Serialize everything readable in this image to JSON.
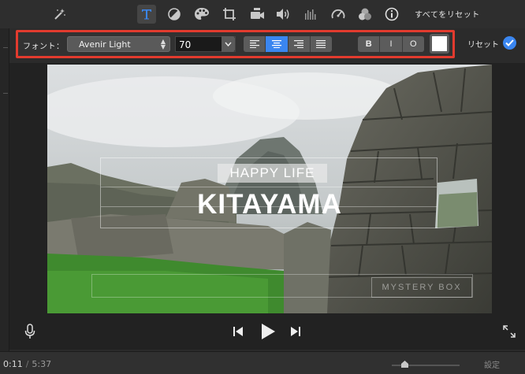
{
  "toolbar": {
    "icons": [
      "magic-wand-icon",
      "title-text-icon",
      "color-balance-icon",
      "color-palette-icon",
      "crop-icon",
      "camera-stabilization-icon",
      "volume-icon",
      "equalizer-icon",
      "speed-icon",
      "filter-icon",
      "info-icon"
    ],
    "active_icon": "title-text-icon",
    "reset_all_label": "すべてをリセット"
  },
  "font_bar": {
    "label": "フォント：",
    "font_name": "Avenir Light",
    "font_size": "70",
    "alignment_options": [
      "left",
      "center",
      "right",
      "justify"
    ],
    "selected_alignment": "center",
    "style_buttons": [
      "B",
      "I",
      "O"
    ],
    "text_color": "#ffffff",
    "reset_label": "リセット"
  },
  "viewer": {
    "subtitle_text": "HAPPY LIFE",
    "title_text": "KITAYAMA",
    "watermark_text": "MYSTERY BOX"
  },
  "transport": {
    "icons": [
      "microphone-icon",
      "skip-back-icon",
      "play-icon",
      "skip-forward-icon",
      "fullscreen-icon"
    ]
  },
  "status": {
    "current_time": "0:11",
    "separator": "/",
    "total_time": "5:37",
    "settings_label": "設定"
  },
  "colors": {
    "accent": "#3a86f0",
    "highlight_border": "#e23b2e",
    "background": "#2b2b2b"
  }
}
